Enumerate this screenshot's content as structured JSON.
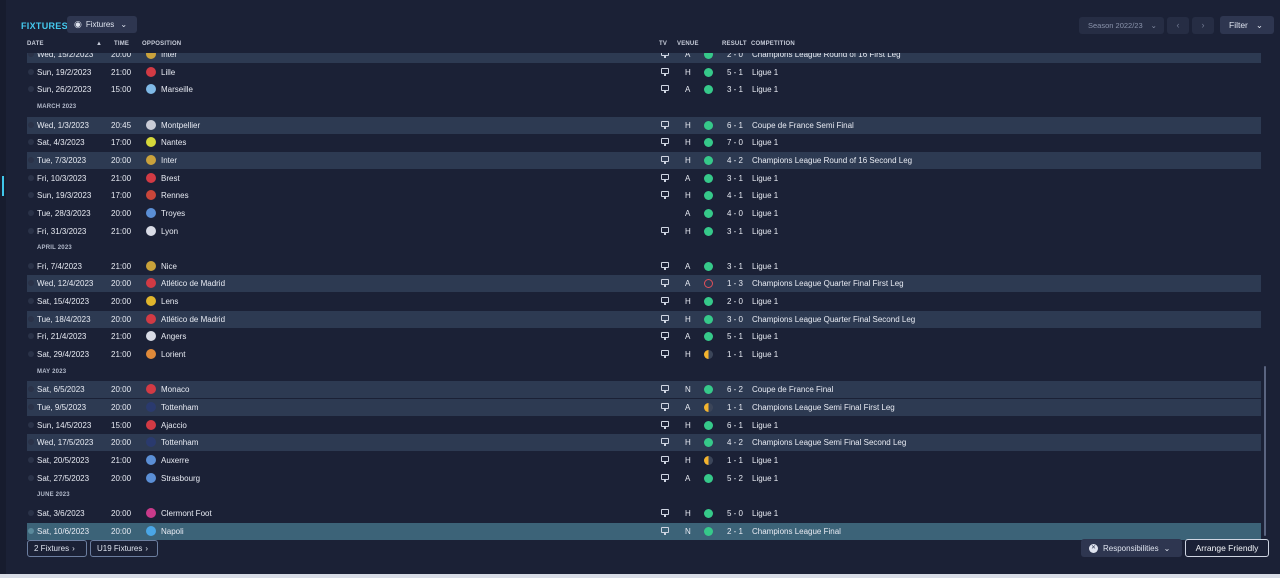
{
  "header": {
    "title": "FIXTURES",
    "view_dropdown": "Fixtures",
    "season": "Season 2022/23",
    "filter_label": "Filter"
  },
  "columns": {
    "date": "DATE",
    "time": "TIME",
    "opposition": "OPPOSITION",
    "tv": "TV",
    "venue": "VENUE",
    "result": "RESULT",
    "competition": "COMPETITION"
  },
  "rows": [
    {
      "kind": "match",
      "alt": true,
      "date": "Wed, 15/2/2023",
      "time": "20:00",
      "team": "Inter",
      "crest": "#caa23c",
      "tv": true,
      "venue": "A",
      "outcome": "w",
      "result": "2 - 0",
      "comp": "Champions League Round of 16 First Leg"
    },
    {
      "kind": "match",
      "alt": false,
      "date": "Sun, 19/2/2023",
      "time": "21:00",
      "team": "Lille",
      "crest": "#d23a44",
      "tv": true,
      "venue": "H",
      "outcome": "w",
      "result": "5 - 1",
      "comp": "Ligue 1"
    },
    {
      "kind": "match",
      "alt": false,
      "date": "Sun, 26/2/2023",
      "time": "15:00",
      "team": "Marseille",
      "crest": "#7fb9e6",
      "tv": true,
      "venue": "A",
      "outcome": "w",
      "result": "3 - 1",
      "comp": "Ligue 1"
    },
    {
      "kind": "month",
      "label": "MARCH 2023"
    },
    {
      "kind": "match",
      "alt": true,
      "date": "Wed, 1/3/2023",
      "time": "20:45",
      "team": "Montpellier",
      "crest": "#c9ccd6",
      "tv": true,
      "venue": "H",
      "outcome": "w",
      "result": "6 - 1",
      "comp": "Coupe de France Semi Final"
    },
    {
      "kind": "match",
      "alt": false,
      "date": "Sat, 4/3/2023",
      "time": "17:00",
      "team": "Nantes",
      "crest": "#d6d83a",
      "tv": true,
      "venue": "H",
      "outcome": "w",
      "result": "7 - 0",
      "comp": "Ligue 1"
    },
    {
      "kind": "match",
      "alt": true,
      "date": "Tue, 7/3/2023",
      "time": "20:00",
      "team": "Inter",
      "crest": "#caa23c",
      "tv": true,
      "venue": "H",
      "outcome": "w",
      "result": "4 - 2",
      "comp": "Champions League Round of 16 Second Leg"
    },
    {
      "kind": "match",
      "alt": false,
      "date": "Fri, 10/3/2023",
      "time": "21:00",
      "team": "Brest",
      "crest": "#d23a44",
      "tv": true,
      "venue": "A",
      "outcome": "w",
      "result": "3 - 1",
      "comp": "Ligue 1"
    },
    {
      "kind": "match",
      "alt": false,
      "date": "Sun, 19/3/2023",
      "time": "17:00",
      "team": "Rennes",
      "crest": "#c9463a",
      "tv": true,
      "venue": "H",
      "outcome": "w",
      "result": "4 - 1",
      "comp": "Ligue 1"
    },
    {
      "kind": "match",
      "alt": false,
      "date": "Tue, 28/3/2023",
      "time": "20:00",
      "team": "Troyes",
      "crest": "#5b8fd6",
      "tv": false,
      "venue": "A",
      "outcome": "w",
      "result": "4 - 0",
      "comp": "Ligue 1"
    },
    {
      "kind": "match",
      "alt": false,
      "date": "Fri, 31/3/2023",
      "time": "21:00",
      "team": "Lyon",
      "crest": "#d9dce6",
      "tv": true,
      "venue": "H",
      "outcome": "w",
      "result": "3 - 1",
      "comp": "Ligue 1"
    },
    {
      "kind": "month",
      "label": "APRIL 2023"
    },
    {
      "kind": "match",
      "alt": false,
      "date": "Fri, 7/4/2023",
      "time": "21:00",
      "team": "Nice",
      "crest": "#c9a23a",
      "tv": true,
      "venue": "A",
      "outcome": "w",
      "result": "3 - 1",
      "comp": "Ligue 1"
    },
    {
      "kind": "match",
      "alt": true,
      "date": "Wed, 12/4/2023",
      "time": "20:00",
      "team": "Atlético de Madrid",
      "crest": "#d23a44",
      "tv": true,
      "venue": "A",
      "outcome": "l",
      "result": "1 - 3",
      "comp": "Champions League Quarter Final First Leg"
    },
    {
      "kind": "match",
      "alt": false,
      "date": "Sat, 15/4/2023",
      "time": "20:00",
      "team": "Lens",
      "crest": "#e0b52c",
      "tv": true,
      "venue": "H",
      "outcome": "w",
      "result": "2 - 0",
      "comp": "Ligue 1"
    },
    {
      "kind": "match",
      "alt": true,
      "date": "Tue, 18/4/2023",
      "time": "20:00",
      "team": "Atlético de Madrid",
      "crest": "#d23a44",
      "tv": true,
      "venue": "H",
      "outcome": "w",
      "result": "3 - 0",
      "comp": "Champions League Quarter Final Second Leg"
    },
    {
      "kind": "match",
      "alt": false,
      "date": "Fri, 21/4/2023",
      "time": "21:00",
      "team": "Angers",
      "crest": "#d9dce6",
      "tv": true,
      "venue": "A",
      "outcome": "w",
      "result": "5 - 1",
      "comp": "Ligue 1"
    },
    {
      "kind": "match",
      "alt": false,
      "date": "Sat, 29/4/2023",
      "time": "21:00",
      "team": "Lorient",
      "crest": "#e08a3a",
      "tv": true,
      "venue": "H",
      "outcome": "d",
      "result": "1 - 1",
      "comp": "Ligue 1"
    },
    {
      "kind": "month",
      "label": "MAY 2023"
    },
    {
      "kind": "match",
      "alt": true,
      "date": "Sat, 6/5/2023",
      "time": "20:00",
      "team": "Monaco",
      "crest": "#d23a44",
      "tv": true,
      "venue": "N",
      "outcome": "w",
      "result": "6 - 2",
      "comp": "Coupe de France Final"
    },
    {
      "kind": "match",
      "alt": true,
      "date": "Tue, 9/5/2023",
      "time": "20:00",
      "team": "Tottenham",
      "crest": "#2a3a6e",
      "tv": true,
      "venue": "A",
      "outcome": "d",
      "result": "1 - 1",
      "comp": "Champions League Semi Final First Leg"
    },
    {
      "kind": "match",
      "alt": false,
      "date": "Sun, 14/5/2023",
      "time": "15:00",
      "team": "Ajaccio",
      "crest": "#d23a44",
      "tv": true,
      "venue": "H",
      "outcome": "w",
      "result": "6 - 1",
      "comp": "Ligue 1"
    },
    {
      "kind": "match",
      "alt": true,
      "date": "Wed, 17/5/2023",
      "time": "20:00",
      "team": "Tottenham",
      "crest": "#2a3a6e",
      "tv": true,
      "venue": "H",
      "outcome": "w",
      "result": "4 - 2",
      "comp": "Champions League Semi Final Second Leg"
    },
    {
      "kind": "match",
      "alt": false,
      "date": "Sat, 20/5/2023",
      "time": "21:00",
      "team": "Auxerre",
      "crest": "#5b8fd6",
      "tv": true,
      "venue": "H",
      "outcome": "d",
      "result": "1 - 1",
      "comp": "Ligue 1"
    },
    {
      "kind": "match",
      "alt": false,
      "date": "Sat, 27/5/2023",
      "time": "20:00",
      "team": "Strasbourg",
      "crest": "#5b8fd6",
      "tv": true,
      "venue": "A",
      "outcome": "w",
      "result": "5 - 2",
      "comp": "Ligue 1"
    },
    {
      "kind": "month",
      "label": "JUNE 2023"
    },
    {
      "kind": "match",
      "alt": false,
      "date": "Sat, 3/6/2023",
      "time": "20:00",
      "team": "Clermont Foot",
      "crest": "#c93a8a",
      "tv": true,
      "venue": "H",
      "outcome": "w",
      "result": "5 - 0",
      "comp": "Ligue 1"
    },
    {
      "kind": "match",
      "alt": false,
      "hl": true,
      "date": "Sat, 10/6/2023",
      "time": "20:00",
      "team": "Napoli",
      "crest": "#4aa6e6",
      "tv": true,
      "venue": "N",
      "outcome": "w",
      "result": "2 - 1",
      "comp": "Champions League Final"
    }
  ],
  "footer": {
    "fixtures_btn": "2 Fixtures",
    "u19_btn": "U19 Fixtures",
    "responsibilities": "Responsibilities",
    "arrange_friendly": "Arrange Friendly"
  },
  "colors": {
    "win": "#36c98a",
    "loss": "#e0505a",
    "draw": "#f4b42e",
    "accent": "#45c9ee"
  }
}
